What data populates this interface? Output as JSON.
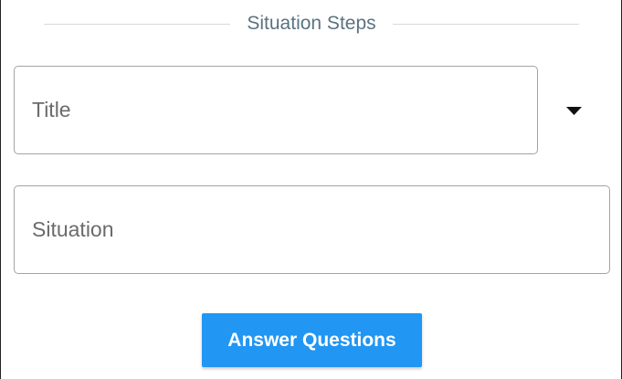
{
  "section": {
    "heading": "Situation Steps"
  },
  "form": {
    "title_field": {
      "placeholder": "Title",
      "value": ""
    },
    "situation_field": {
      "placeholder": "Situation",
      "value": ""
    }
  },
  "actions": {
    "answer_questions_label": "Answer Questions"
  },
  "icons": {
    "dropdown": "caret-down-icon"
  },
  "colors": {
    "accent": "#2196f3",
    "heading_text": "#5b7381",
    "divider": "#d6dadd",
    "field_border": "#a3a3a3"
  }
}
